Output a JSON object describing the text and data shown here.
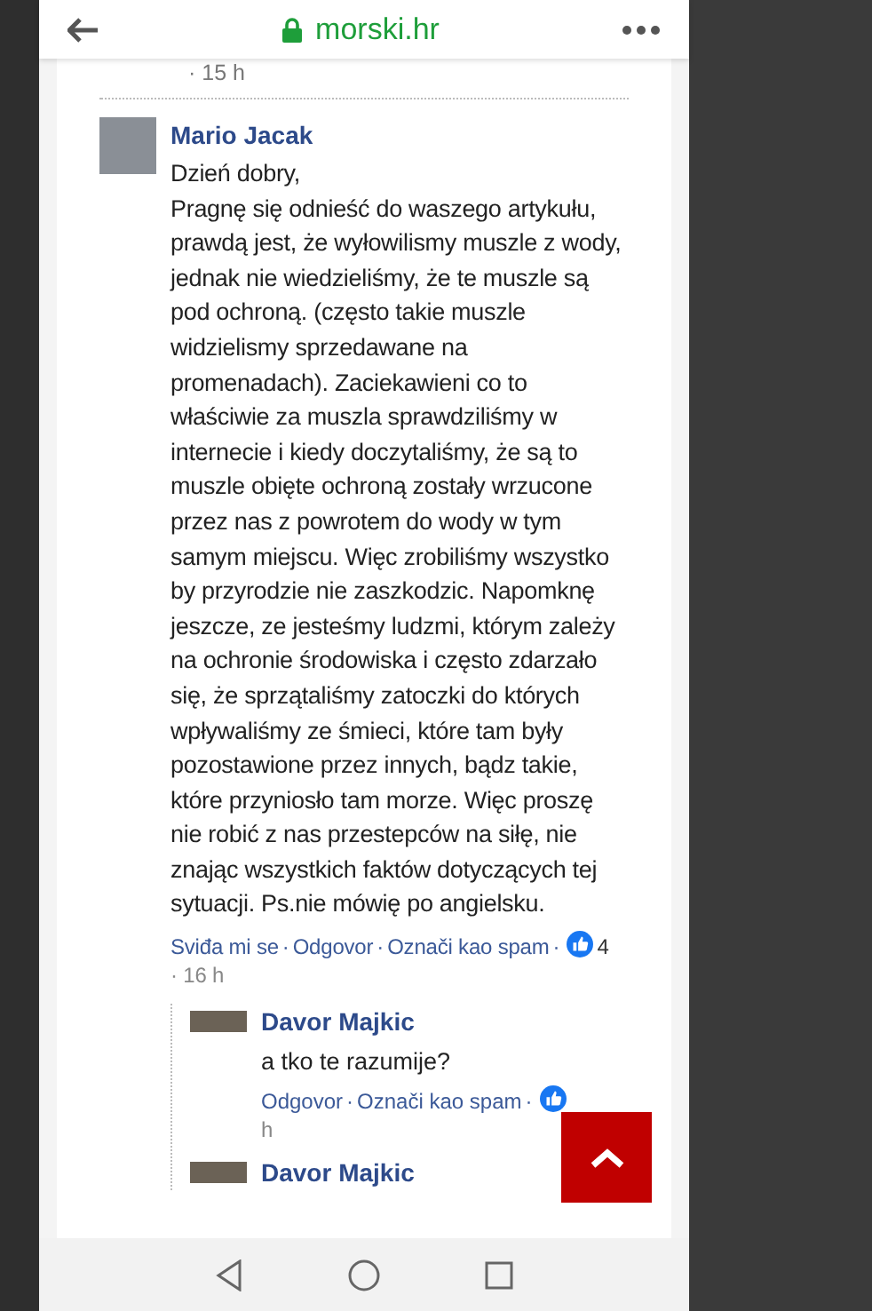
{
  "browser": {
    "url": "morski.hr"
  },
  "previous_time": "· 15 h",
  "comment": {
    "author": "Mario Jacak",
    "paragraphs": [
      "Dzień dobry,",
      "Pragnę się odnieść do waszego artykułu, prawdą jest, że wyłowilismy muszle z wody, jednak nie wiedzieliśmy, że te muszle są pod ochroną. (często takie muszle widzielismy sprzedawane na promenadach). Zaciekawieni co to właściwie za muszla sprawdziliśmy w internecie i kiedy doczytaliśmy, że są to muszle obięte ochroną zostały wrzucone przez nas z powrotem do wody w tym samym miejscu. Więc zrobiliśmy wszystko by przyrodzie nie zaszkodzic. Napomknę jeszcze, ze jesteśmy ludzmi, którym zależy na ochronie środowiska i często zdarzało się, że sprzątaliśmy zatoczki do których wpływaliśmy ze śmieci, które tam były pozostawione przez innych, bądz takie, które przyniosło tam morze. Więc proszę nie robić z nas przestepców na siłę, nie znając wszystkich faktów dotyczących tej sytuacji. Ps.nie mówię po angielsku."
    ],
    "actions": [
      "Sviđa mi se",
      "Odgovor",
      "Označi kao spam"
    ],
    "separator": "·",
    "likes": "4",
    "time": "· 16 h"
  },
  "replies": [
    {
      "author": "Davor Majkic",
      "text": "a tko te razumije?",
      "actions": [
        "Odgovor",
        "Označi kao spam"
      ],
      "separator": "·",
      "time": "h"
    },
    {
      "author": "Davor Majkic"
    }
  ]
}
